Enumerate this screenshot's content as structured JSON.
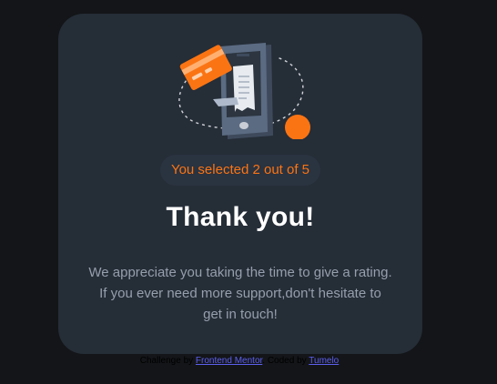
{
  "colors": {
    "background": "#131518",
    "card": "#252d37",
    "accent": "#fb7413",
    "heading": "#ffffff",
    "body_text": "#969fad",
    "link": "#5d5fef"
  },
  "card": {
    "illustration_icon": "phone-receipt-card-illustration",
    "selection_text": "You selected 2 out of 5",
    "title": "Thank you!",
    "message_line1": "We appreciate you taking the time to give a rating.",
    "message_line2": "If you ever need more support,don't hesitate to",
    "message_line3": "get in touch!"
  },
  "attribution": {
    "prefix": "Challenge by",
    "link1": "Frontend Mentor",
    "middle": ". Coded by",
    "link2": "Tumelo"
  }
}
